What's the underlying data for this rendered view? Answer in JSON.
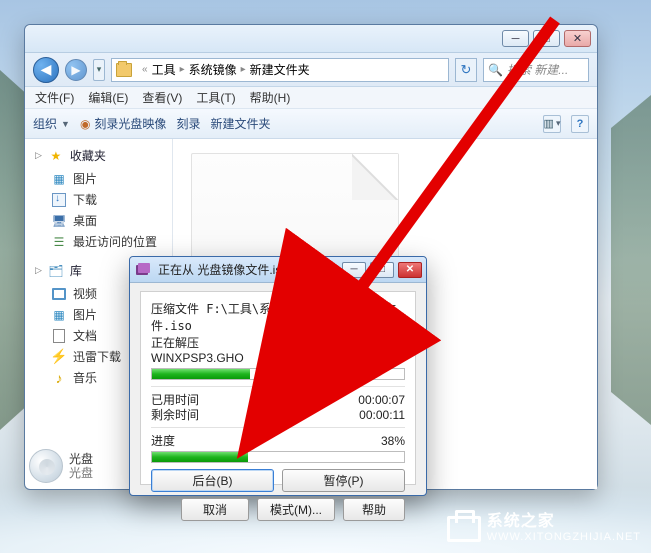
{
  "explorer": {
    "breadcrumbs": [
      "工具",
      "系统镜像",
      "新建文件夹"
    ],
    "refresh_icon": "↻",
    "search_placeholder": "搜索 新建...",
    "menus": {
      "file": "文件(F)",
      "edit": "编辑(E)",
      "view": "查看(V)",
      "tools": "工具(T)",
      "help": "帮助(H)"
    },
    "toolbar": {
      "organize": "组织",
      "burn_image": "刻录光盘映像",
      "burn": "刻录",
      "new_folder": "新建文件夹"
    },
    "side_fav_header": "收藏夹",
    "side_fav": [
      {
        "icon": "pic",
        "label": "图片"
      },
      {
        "icon": "dl",
        "label": "下载"
      },
      {
        "icon": "desk",
        "label": "桌面"
      },
      {
        "icon": "rec",
        "label": "最近访问的位置"
      }
    ],
    "side_lib_header": "库",
    "side_lib": [
      {
        "icon": "vid",
        "label": "视频"
      },
      {
        "icon": "pic",
        "label": "图片"
      },
      {
        "icon": "doc",
        "label": "文档"
      },
      {
        "icon": "thun",
        "label": "迅雷下载"
      },
      {
        "icon": "music",
        "label": "音乐"
      }
    ],
    "selected": {
      "line1": "光盘",
      "line2": "光盘"
    }
  },
  "dialog": {
    "title": "正在从 光盘镜像文件.iso 中提取",
    "archive_line": "压缩文件 F:\\工具\\系统镜像...\\光盘镜像文件.iso",
    "extracting": "正在解压",
    "current_file": "WINXPSP3.GHO",
    "file_percent": "39%",
    "file_percent_val": 39,
    "elapsed_label": "已用时间",
    "elapsed": "00:00:07",
    "remain_label": "剩余时间",
    "remain": "00:00:11",
    "progress_label": "进度",
    "progress": "38%",
    "progress_val": 38,
    "buttons": {
      "bg": "后台(B)",
      "pause": "暂停(P)",
      "cancel": "取消",
      "mode": "模式(M)...",
      "help": "帮助"
    }
  },
  "watermark": {
    "name": "系统之家",
    "url": "WWW.XITONGZHIJIA.NET"
  }
}
